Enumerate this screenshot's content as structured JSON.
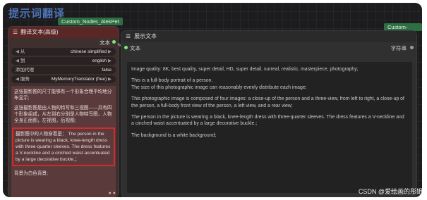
{
  "group": {
    "title": "提示词翻译",
    "left_tag": "Custom_Nodes_AlekPet",
    "right_tag": "Custom-Scripts"
  },
  "left_node": {
    "title": "翻译文本(高级)",
    "output_label": "文本",
    "widgets": [
      {
        "label": "从",
        "value": "chinese simplified"
      },
      {
        "label": "到",
        "value": "english"
      },
      {
        "label": "添加代理",
        "value": "false"
      },
      {
        "label": "服务",
        "value": "MyMemoryTranslator (free)"
      }
    ],
    "paragraphs": [
      "这张摄影图的尺寸能够有一个形象合理平均地分布显示;",
      "这张摄影图是由人物的特写和三视图——共有四个形象组成，从左到右分别是人物特写图，人物全身正面图，左视图，后视图;"
    ],
    "highlighted": "摄影图中的人物穿着是： The person in the picture is wearing a black, knee-length dress with three-quarter sleeves. The dress features a V-neckline and a cinched waist accentuated by a large decorative buckle.；",
    "last_paragraph": "背景为白色背景;"
  },
  "right_node": {
    "title": "展示文本",
    "input_label": "文本",
    "output_label": "字符串",
    "paragraphs": [
      "Image quality: 8K, best quality, super detail, HD, super detail, surreal, realistic, masterpiece, photography;",
      "This is a full-body portrait of a person.\nThe size of this photographic image can reasonably evenly distribute each image;",
      "This photographic image is composed of four images: a close-up of the person and a three-view, from left to right, a close-up of the person, a full-body front view of the person, a left view, and a rear view;",
      "The person in the picture is wearing a black, knee-length dress with three-quarter sleeves. The dress features a V-neckline and a cinched waist accentuated by a large decorative buckle.;",
      "The background is a white background;"
    ]
  },
  "watermark": "CSDN @爱绘画的彤姐"
}
